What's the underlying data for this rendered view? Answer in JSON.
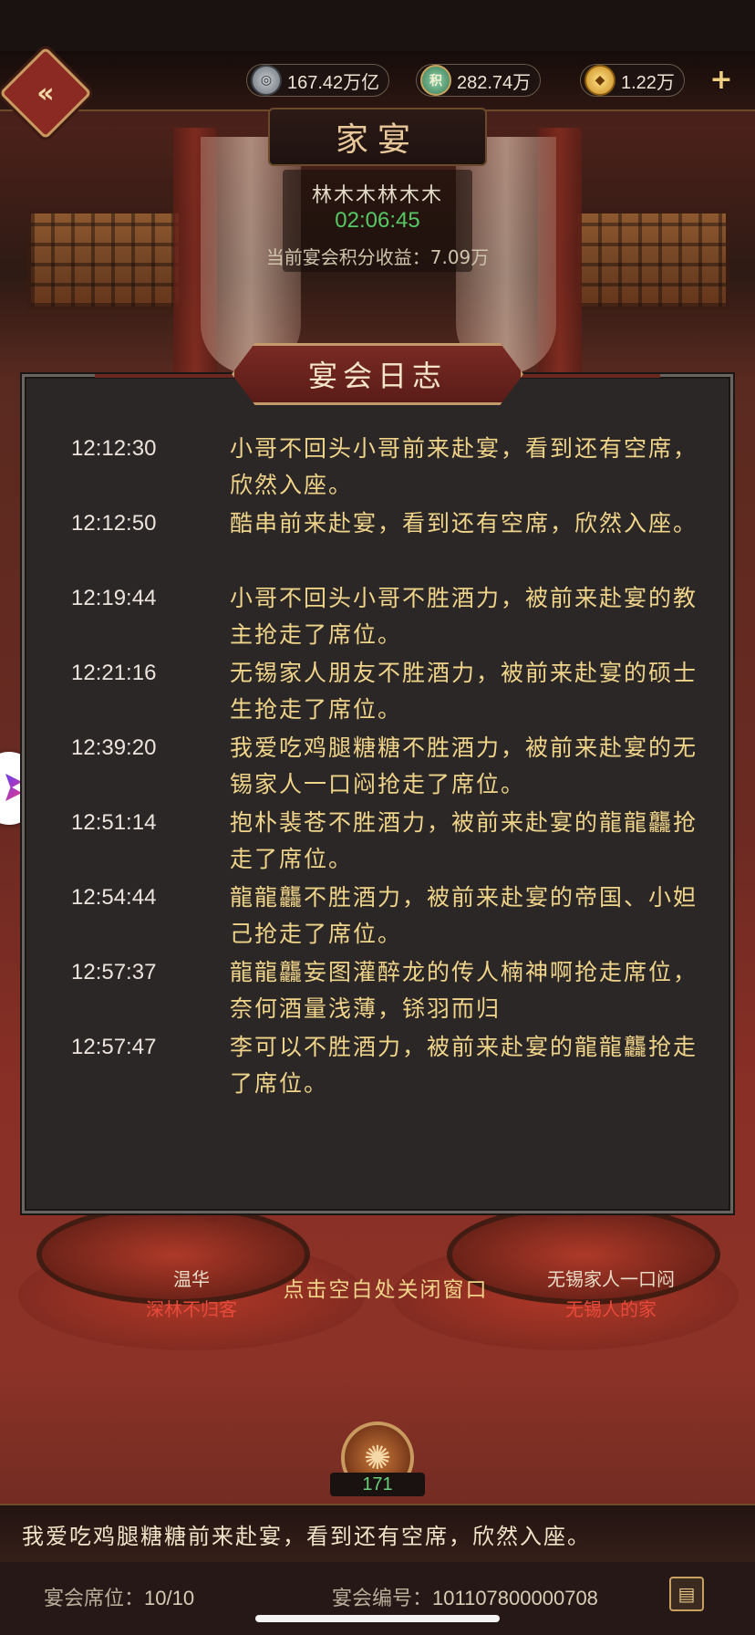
{
  "header": {
    "resources": [
      {
        "icon": "silver-coin-icon",
        "value": "167.42万亿"
      },
      {
        "icon": "jade-token-icon",
        "glyph": "积",
        "value": "282.74万"
      },
      {
        "icon": "gold-ingot-icon",
        "value": "1.22万"
      }
    ]
  },
  "banquet": {
    "title": "家宴",
    "host": "林木木林木木",
    "countdown": "02:06:45",
    "score_label": "当前宴会积分收益：7.09万"
  },
  "log": {
    "title": "宴会日志",
    "entries": [
      {
        "time": "12:12:30",
        "text": "小哥不回头小哥前来赴宴，看到还有空席，欣然入座。"
      },
      {
        "time": "12:12:50",
        "text": "酷串前来赴宴，看到还有空席，欣然入座。"
      },
      {
        "time": "12:19:44",
        "text": "小哥不回头小哥不胜酒力，被前来赴宴的教主抢走了席位。"
      },
      {
        "time": "12:21:16",
        "text": "无锡家人朋友不胜酒力，被前来赴宴的硕士生抢走了席位。"
      },
      {
        "time": "12:39:20",
        "text": "我爱吃鸡腿糖糖不胜酒力，被前来赴宴的无锡家人一口闷抢走了席位。"
      },
      {
        "time": "12:51:14",
        "text": "抱朴裴苍不胜酒力，被前来赴宴的龍龍龘抢走了席位。"
      },
      {
        "time": "12:54:44",
        "text": "龍龍龘不胜酒力，被前来赴宴的帝国、小妲己抢走了席位。"
      },
      {
        "time": "12:57:37",
        "text": "龍龍龘妄图灌醉龙的传人楠神啊抢走席位，奈何酒量浅薄，铩羽而归"
      },
      {
        "time": "12:57:47",
        "text": "李可以不胜酒力，被前来赴宴的龍龍龘抢走了席位。"
      }
    ]
  },
  "seats": {
    "left": {
      "name": "温华",
      "title": "深林不归客"
    },
    "right": {
      "name": "无锡家人一口闷",
      "title": "无锡人的家"
    }
  },
  "close_hint": "点击空白处关闭窗口",
  "guest_count": "171",
  "ticker": "我爱吃鸡腿糖糖前来赴宴，看到还有空席，欣然入座。",
  "footer": {
    "seats_label": "宴会席位：",
    "seats_value": "10/10",
    "id_label": "宴会编号：",
    "id_value": "101107800000708"
  }
}
